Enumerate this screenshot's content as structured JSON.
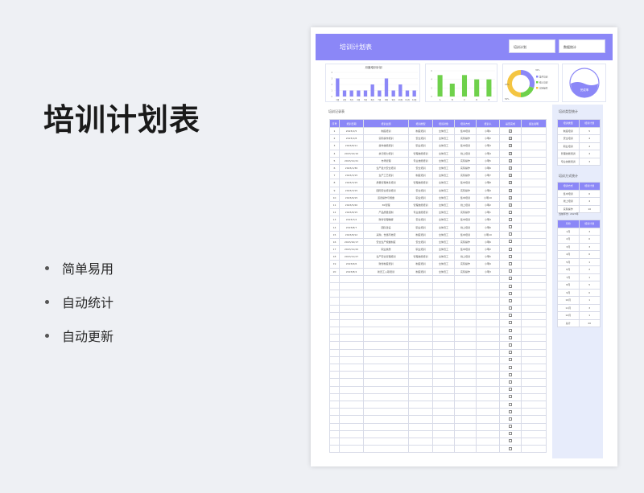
{
  "promo": {
    "title": "培训计划表",
    "features": [
      "简单易用",
      "自动统计",
      "自动更新"
    ]
  },
  "sheet": {
    "title": "培训计划表",
    "header_boxes": [
      "培训计划",
      "数据统计"
    ],
    "table_title": "培训记录表",
    "columns": [
      "序号",
      "培训日期",
      "培训主题",
      "培训类型",
      "培训对象",
      "培训方式",
      "培训人",
      "是否完成",
      "备注说明"
    ],
    "rows": [
      [
        "1",
        "2023/1/5",
        "制度培训",
        "制度培训",
        "全体员工",
        "集中培训",
        "小明1",
        "✔",
        ""
      ],
      [
        "2",
        "2023/1/8",
        "实际操作培训",
        "安全培训",
        "全体员工",
        "实际操作",
        "小明2",
        "✔",
        ""
      ],
      [
        "3",
        "2023/8/11",
        "操作技能培训",
        "职业培训",
        "全体员工",
        "集中培训",
        "小明3",
        "✔",
        ""
      ],
      [
        "4",
        "2023/12/10",
        "执行能力培训",
        "管理技能培训",
        "全体员工",
        "线上培训",
        "小明4",
        "✔",
        ""
      ],
      [
        "5",
        "2023/11/21",
        "市场管理",
        "专业技能培训",
        "全体员工",
        "实际操作",
        "小明5",
        "✔",
        ""
      ],
      [
        "6",
        "2023/1/30",
        "生产最大安全培训",
        "安全培训",
        "全体员工",
        "实际操作",
        "小明6",
        "✔",
        ""
      ],
      [
        "7",
        "2023/3/15",
        "生产工艺培训",
        "制度培训",
        "全体员工",
        "实际操作",
        "小明7",
        "✔",
        ""
      ],
      [
        "8",
        "2023/3/15",
        "质量管理体系培训",
        "管理技能培训",
        "全体员工",
        "集中培训",
        "小明8",
        "✔",
        ""
      ],
      [
        "9",
        "2023/3/15",
        "国际安全培训培训",
        "安全培训",
        "全体员工",
        "实际操作",
        "小明9",
        "✔",
        ""
      ],
      [
        "10",
        "2023/6/15",
        "道德操作与规章",
        "职业培训",
        "全体员工",
        "集中培训",
        "小明10",
        "✔",
        ""
      ],
      [
        "11",
        "2023/5/20",
        "6S管理",
        "管理技能培训",
        "全体员工",
        "线上培训",
        "小明2",
        "✔",
        ""
      ],
      [
        "12",
        "2023/8/15",
        "产品质量控制",
        "专业技能培训",
        "全体员工",
        "实际操作",
        "小明1",
        "☐",
        ""
      ],
      [
        "13",
        "2023/7/2",
        "财务管理精解",
        "安全培训",
        "全体员工",
        "集中培训",
        "小明3",
        "☐",
        ""
      ],
      [
        "14",
        "2023/8/7",
        "团队建设",
        "职业培训",
        "全体员工",
        "线上培训",
        "小明6",
        "☐",
        ""
      ],
      [
        "15",
        "2023/8/12",
        "采购、仓储与物流",
        "制度培训",
        "全体员工",
        "集中培训",
        "小明10",
        "☐",
        ""
      ],
      [
        "16",
        "2023/10/17",
        "安全生产规章制度",
        "安全培训",
        "全体员工",
        "实际操作",
        "小明6",
        "☐",
        ""
      ],
      [
        "17",
        "2023/11/22",
        "职业素质",
        "职业培训",
        "全体员工",
        "集中培训",
        "小明2",
        "☐",
        ""
      ],
      [
        "18",
        "2023/11/27",
        "生产安全管理培训",
        "管理技能培训",
        "全体员工",
        "线上培训",
        "小明5",
        "☐",
        ""
      ],
      [
        "19",
        "2023/6/6",
        "财务制度培训",
        "制度培训",
        "全体员工",
        "实际操作",
        "小明9",
        "☐",
        ""
      ],
      [
        "20",
        "2023/8/4",
        "新员工入职培训",
        "制度培训",
        "全体员工",
        "实际操作",
        "小明3",
        "☐",
        ""
      ]
    ],
    "empty_rows": 24,
    "side_type_title": "培训类型统计",
    "side_type_headers": [
      "培训类型",
      "培训计划"
    ],
    "side_type_rows": [
      [
        "制度培训",
        "5"
      ],
      [
        "安全培训",
        "4"
      ],
      [
        "职业培训",
        "4"
      ],
      [
        "管理技能培训",
        "4"
      ],
      [
        "专业技能培训",
        "3"
      ]
    ],
    "side_mode_title": "培训方式统计",
    "side_mode_headers": [
      "培训方式",
      "培训计划"
    ],
    "side_mode_rows": [
      [
        "集中培训",
        "6"
      ],
      [
        "线上培训",
        "4"
      ],
      [
        "实际操作",
        "10"
      ]
    ],
    "year_label": "当前年份:",
    "year_value": "2023年",
    "side_month_headers": [
      "月份",
      "培训计划"
    ],
    "side_month_rows": [
      [
        "1月",
        "3"
      ],
      [
        "2月",
        "0"
      ],
      [
        "3月",
        "3"
      ],
      [
        "4月",
        "0"
      ],
      [
        "5月",
        "1"
      ],
      [
        "6月",
        "2"
      ],
      [
        "7月",
        "1"
      ],
      [
        "8月",
        "5"
      ],
      [
        "9月",
        "0"
      ],
      [
        "10月",
        "1"
      ],
      [
        "11月",
        "3"
      ],
      [
        "12月",
        "1"
      ],
      [
        "总计",
        "20"
      ]
    ],
    "donut_legend": [
      "集中培训",
      "线上培训",
      "实际操作"
    ],
    "donut_pcts": [
      "30%",
      "20%",
      "50%"
    ],
    "gauge_label": "完成率",
    "colors": {
      "accent": "#8b87f7",
      "green": "#6fd14b",
      "yellow": "#f4c542",
      "bar": "#8b87f7"
    }
  },
  "chart_data": [
    {
      "type": "bar",
      "title": "月度培训计划",
      "categories": [
        "1月",
        "2月",
        "3月",
        "4月",
        "5月",
        "6月",
        "7月",
        "8月",
        "9月",
        "10月",
        "11月",
        "12月"
      ],
      "values": [
        3,
        1,
        1,
        1,
        1,
        2,
        1,
        3,
        1,
        2,
        1,
        1
      ],
      "ylim": [
        0,
        4
      ]
    },
    {
      "type": "bar",
      "categories": [
        "A",
        "B",
        "C",
        "D",
        "E"
      ],
      "values": [
        5,
        3,
        5,
        4,
        4
      ],
      "ylim": [
        0,
        6
      ]
    },
    {
      "type": "pie",
      "categories": [
        "集中培训",
        "线上培训",
        "实际操作"
      ],
      "values": [
        30,
        20,
        50
      ]
    }
  ]
}
